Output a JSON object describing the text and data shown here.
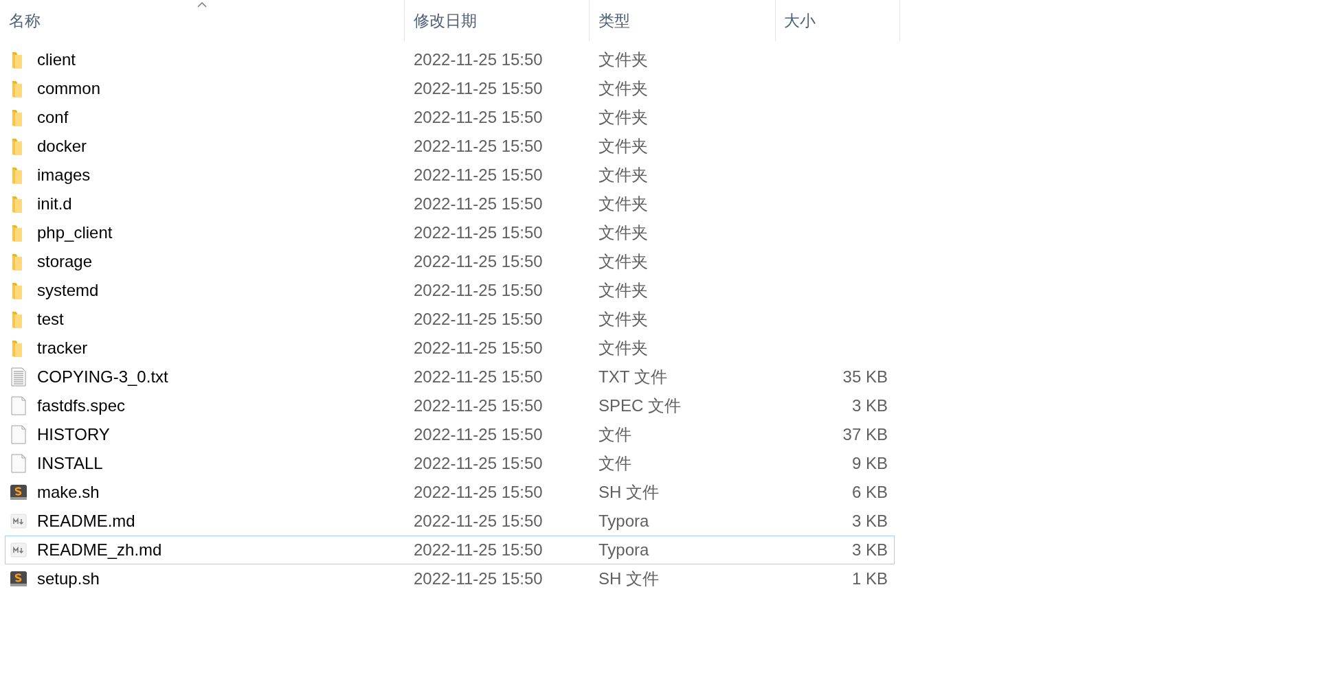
{
  "columns": [
    {
      "label": "名称",
      "sorted": true
    },
    {
      "label": "修改日期",
      "sorted": false
    },
    {
      "label": "类型",
      "sorted": false
    },
    {
      "label": "大小",
      "sorted": false
    }
  ],
  "rows": [
    {
      "kind": "folder",
      "name": "client",
      "date": "2022-11-25 15:50",
      "type": "文件夹",
      "focused": false
    },
    {
      "kind": "folder",
      "name": "common",
      "date": "2022-11-25 15:50",
      "type": "文件夹",
      "focused": false
    },
    {
      "kind": "folder",
      "name": "conf",
      "date": "2022-11-25 15:50",
      "type": "文件夹",
      "focused": false
    },
    {
      "kind": "folder",
      "name": "docker",
      "date": "2022-11-25 15:50",
      "type": "文件夹",
      "focused": false
    },
    {
      "kind": "folder",
      "name": "images",
      "date": "2022-11-25 15:50",
      "type": "文件夹",
      "focused": false
    },
    {
      "kind": "folder",
      "name": "init.d",
      "date": "2022-11-25 15:50",
      "type": "文件夹",
      "focused": false
    },
    {
      "kind": "folder",
      "name": "php_client",
      "date": "2022-11-25 15:50",
      "type": "文件夹",
      "focused": false
    },
    {
      "kind": "folder",
      "name": "storage",
      "date": "2022-11-25 15:50",
      "type": "文件夹",
      "focused": false
    },
    {
      "kind": "folder",
      "name": "systemd",
      "date": "2022-11-25 15:50",
      "type": "文件夹",
      "focused": false
    },
    {
      "kind": "folder",
      "name": "test",
      "date": "2022-11-25 15:50",
      "type": "文件夹",
      "focused": false
    },
    {
      "kind": "folder",
      "name": "tracker",
      "date": "2022-11-25 15:50",
      "type": "文件夹",
      "focused": false
    },
    {
      "kind": "text",
      "name": "COPYING-3_0.txt",
      "date": "2022-11-25 15:50",
      "type": "TXT 文件",
      "size": "35 KB",
      "focused": false
    },
    {
      "kind": "file",
      "name": "fastdfs.spec",
      "date": "2022-11-25 15:50",
      "type": "SPEC 文件",
      "size": "3 KB",
      "focused": false
    },
    {
      "kind": "file",
      "name": "HISTORY",
      "date": "2022-11-25 15:50",
      "type": "文件",
      "size": "37 KB",
      "focused": false
    },
    {
      "kind": "file",
      "name": "INSTALL",
      "date": "2022-11-25 15:50",
      "type": "文件",
      "size": "9 KB",
      "focused": false
    },
    {
      "kind": "shell",
      "name": "make.sh",
      "date": "2022-11-25 15:50",
      "type": "SH 文件",
      "size": "6 KB",
      "focused": false
    },
    {
      "kind": "markdown",
      "name": "README.md",
      "date": "2022-11-25 15:50",
      "type": "Typora",
      "size": "3 KB",
      "focused": false
    },
    {
      "kind": "markdown",
      "name": "README_zh.md",
      "date": "2022-11-25 15:50",
      "type": "Typora",
      "size": "3 KB",
      "focused": true
    },
    {
      "kind": "shell",
      "name": "setup.sh",
      "date": "2022-11-25 15:50",
      "type": "SH 文件",
      "size": "1 KB",
      "focused": false
    }
  ]
}
